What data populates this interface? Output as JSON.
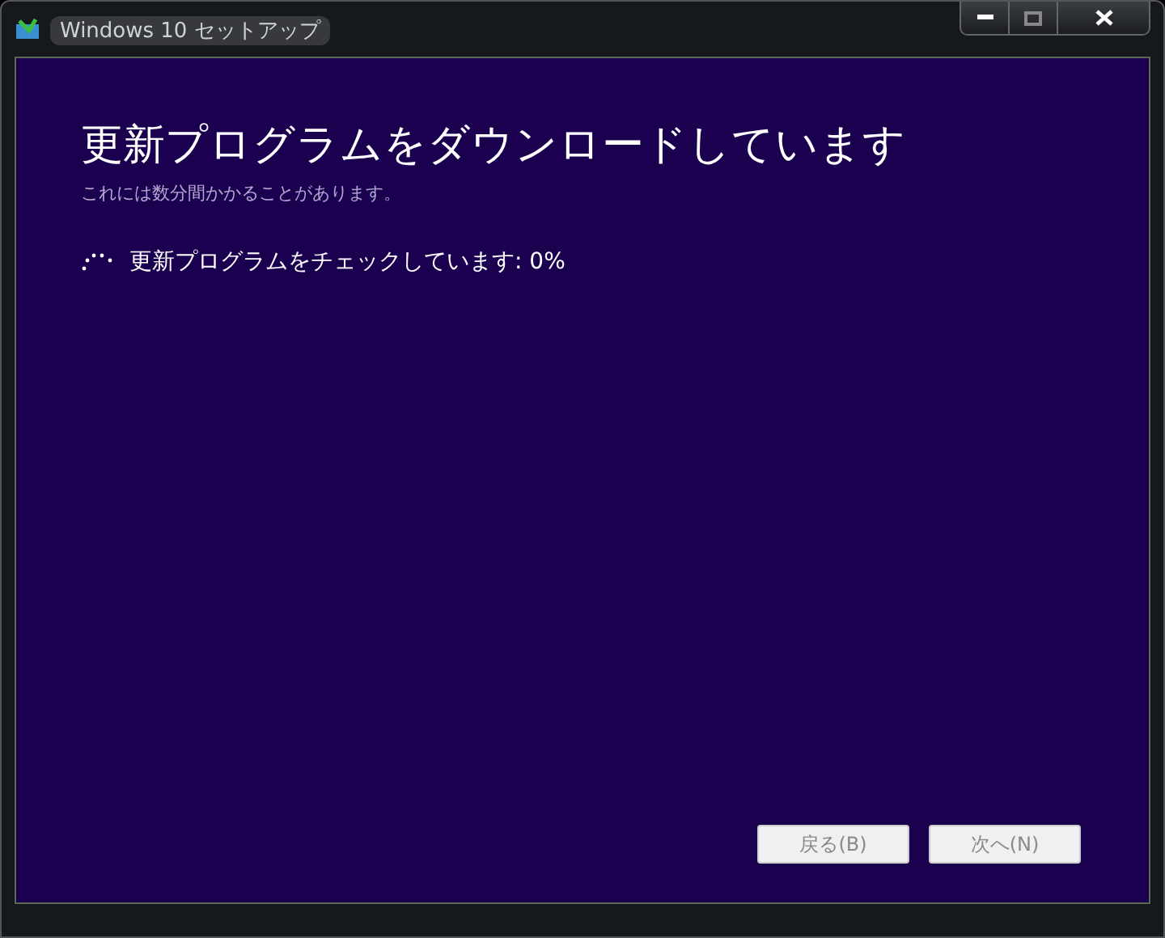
{
  "window": {
    "title": "Windows 10 セットアップ"
  },
  "heading": "更新プログラムをダウンロードしています",
  "subtitle": "これには数分間かかることがあります。",
  "status": "更新プログラムをチェックしています: 0%",
  "buttons": [
    {
      "label": "戻る(B)",
      "disabled": true
    },
    {
      "label": "次へ(N)",
      "disabled": true
    }
  ]
}
